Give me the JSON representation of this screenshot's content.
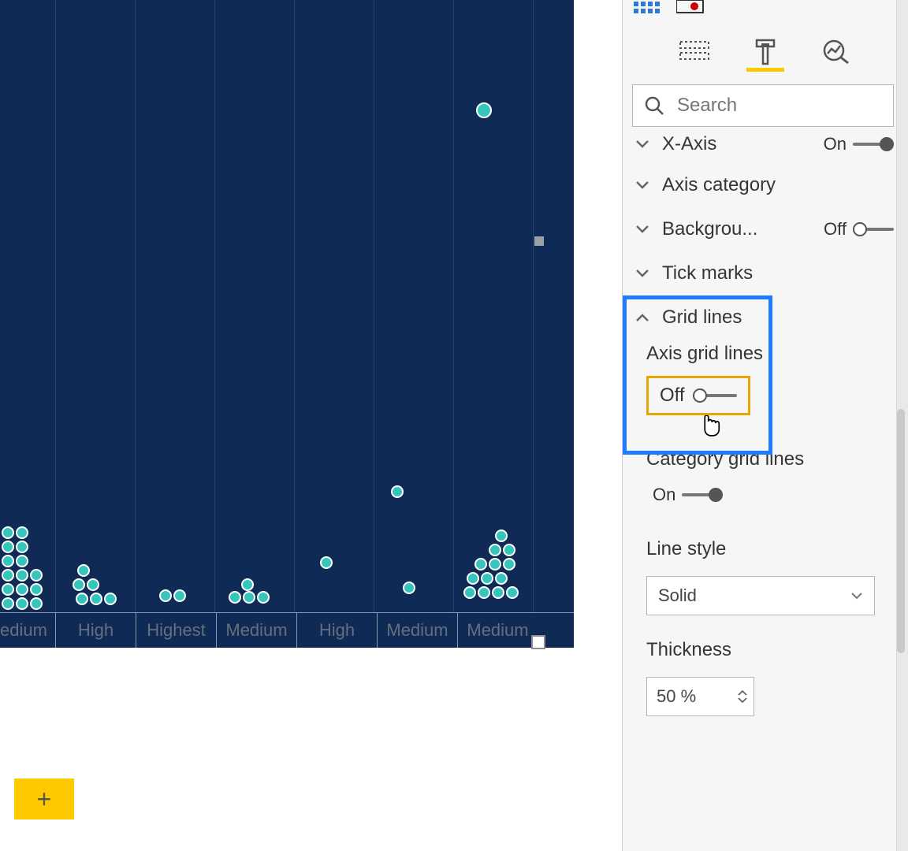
{
  "chart_data": {
    "type": "scatter",
    "categories": [
      "edium",
      "High",
      "Highest",
      "Medium",
      "High",
      "Medium",
      "Medium"
    ],
    "note": "x-axis categories partially cropped on left; y-axis not visible in crop",
    "series": [
      {
        "name": "points",
        "values": []
      }
    ]
  },
  "axis": {
    "labels": [
      "edium",
      "High",
      "Highest",
      "Medium",
      "High",
      "Medium",
      "Medium"
    ]
  },
  "panel": {
    "search_placeholder": "Search",
    "items": {
      "xaxis": {
        "label": "X-Axis",
        "toggle": "On"
      },
      "axiscat": {
        "label": "Axis category"
      },
      "background": {
        "label": "Backgrou...",
        "toggle": "Off"
      },
      "ticks": {
        "label": "Tick marks"
      },
      "gridlines": {
        "label": "Grid lines"
      },
      "axisgrid": {
        "label": "Axis grid lines",
        "toggle": "Off"
      },
      "catgrid": {
        "label": "Category grid lines",
        "toggle": "On"
      },
      "linestyle_label": "Line style",
      "linestyle_value": "Solid",
      "thickness_label": "Thickness",
      "thickness_value": "50  %"
    }
  },
  "pagebar": {
    "plus": "+"
  }
}
